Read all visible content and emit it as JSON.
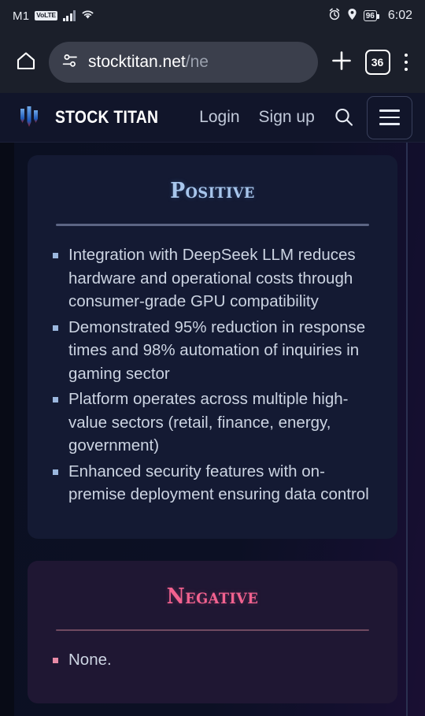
{
  "statusbar": {
    "carrier": "M1",
    "network_badge": "VoLTE",
    "battery_level": "96",
    "time": "6:02",
    "icons": [
      "signal-bars-icon",
      "wifi-icon",
      "alarm-icon",
      "location-pin-icon",
      "battery-icon"
    ]
  },
  "browser": {
    "home_icon": "home-icon",
    "site_settings_icon": "site-settings-icon",
    "url_main": "stocktitan.net",
    "url_path": "/ne",
    "new_tab_icon": "plus-icon",
    "tab_count": "36",
    "menu_icon": "three-dot-menu-icon"
  },
  "site_header": {
    "logo_name": "stock-titan-logo",
    "brand": "STOCK TITAN",
    "login": "Login",
    "signup": "Sign up",
    "search_icon": "search-icon",
    "menu_icon": "hamburger-menu-icon"
  },
  "sections": {
    "positive": {
      "title": "Positive",
      "accent_color": "#a8c6ec",
      "background": "#141a33",
      "bullets": [
        "Integration with DeepSeek LLM reduces hardware and operational costs through consumer-grade GPU compatibility",
        "Demonstrated 95% reduction in response times and 98% automation of inquiries in gaming sector",
        "Platform operates across multiple high-value sectors (retail, finance, energy, government)",
        "Enhanced security features with on-premise deployment ensuring data control"
      ]
    },
    "negative": {
      "title": "Negative",
      "accent_color": "#f2628f",
      "background": "#1f1733",
      "bullets": [
        "None."
      ]
    }
  }
}
